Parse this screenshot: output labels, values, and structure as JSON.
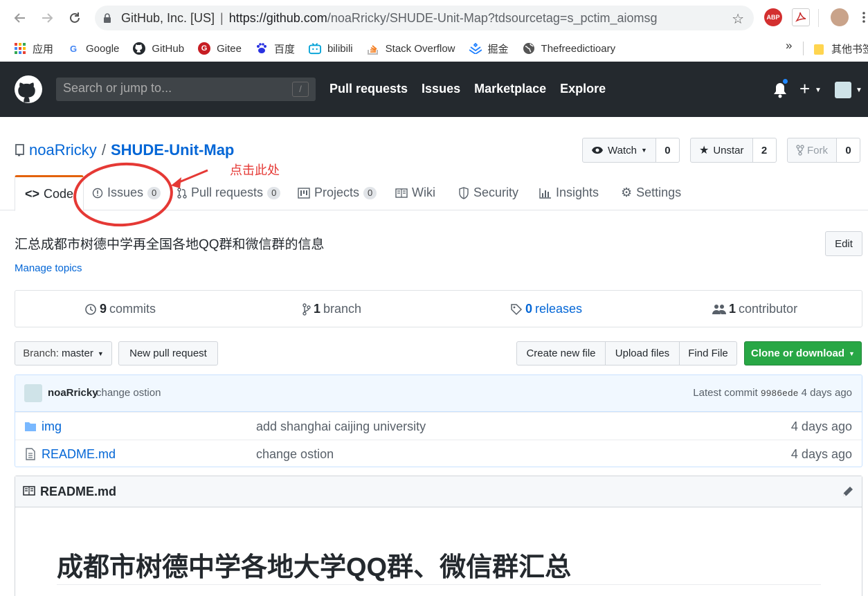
{
  "browser": {
    "org": "GitHub, Inc. [US]",
    "url_host": "https://github.com",
    "url_rest": "/noaRricky/SHUDE-Unit-Map?tdsourcetag=s_pctim_aiomsg",
    "extensions": [
      "ABP"
    ]
  },
  "bookmarks": {
    "items": [
      {
        "label": "应用",
        "icon": "apps-grid-icon"
      },
      {
        "label": "Google",
        "icon": "google-icon"
      },
      {
        "label": "GitHub",
        "icon": "github-icon"
      },
      {
        "label": "Gitee",
        "icon": "gitee-icon"
      },
      {
        "label": "百度",
        "icon": "baidu-icon"
      },
      {
        "label": "bilibili",
        "icon": "bilibili-icon"
      },
      {
        "label": "Stack Overflow",
        "icon": "stackoverflow-icon"
      },
      {
        "label": "掘金",
        "icon": "juejin-icon"
      },
      {
        "label": "Thefreedictioary",
        "icon": "globe-icon"
      }
    ],
    "overflow": "»",
    "other_folder": "其他书签"
  },
  "header": {
    "search_placeholder": "Search or jump to...",
    "search_shortcut": "/",
    "nav": [
      "Pull requests",
      "Issues",
      "Marketplace",
      "Explore"
    ]
  },
  "repo": {
    "owner": "noaRricky",
    "name": "SHUDE-Unit-Map",
    "watch_label": "Watch",
    "watch_count": "0",
    "star_label": "Unstar",
    "star_count": "2",
    "fork_label": "Fork",
    "fork_count": "0"
  },
  "annotation": {
    "text": "点击此处",
    "color": "#e53935"
  },
  "tabs": [
    {
      "label": "Code",
      "count": null
    },
    {
      "label": "Issues",
      "count": "0"
    },
    {
      "label": "Pull requests",
      "count": "0"
    },
    {
      "label": "Projects",
      "count": "0"
    },
    {
      "label": "Wiki",
      "count": null
    },
    {
      "label": "Security",
      "count": null
    },
    {
      "label": "Insights",
      "count": null
    },
    {
      "label": "Settings",
      "count": null
    }
  ],
  "about": {
    "description": "汇总成都市树德中学再全国各地QQ群和微信群的信息",
    "manage_topics": "Manage topics",
    "edit_label": "Edit"
  },
  "summary": {
    "commits_count": "9",
    "commits_label": "commits",
    "branch_count": "1",
    "branch_label": "branch",
    "releases_count": "0",
    "releases_label": "releases",
    "contributor_count": "1",
    "contributor_label": "contributor"
  },
  "file_nav": {
    "branch_prefix": "Branch:",
    "branch_name": "master",
    "new_pr": "New pull request",
    "create_file": "Create new file",
    "upload_files": "Upload files",
    "find_file": "Find File",
    "clone": "Clone or download"
  },
  "commit": {
    "author": "noaRricky",
    "message": "change ostion",
    "latest_label": "Latest commit",
    "sha": "9986ede",
    "age": "4 days ago"
  },
  "files": [
    {
      "name": "img",
      "type": "folder",
      "message": "add shanghai caijing university",
      "age": "4 days ago"
    },
    {
      "name": "README.md",
      "type": "file",
      "message": "change ostion",
      "age": "4 days ago"
    }
  ],
  "readme": {
    "title": "README.md",
    "heading": "成都市树德中学各地大学QQ群、微信群汇总"
  },
  "colors": {
    "header_bg": "#24292e",
    "link": "#0366d6",
    "clone_green": "#28a745",
    "tab_accent": "#e36209"
  }
}
